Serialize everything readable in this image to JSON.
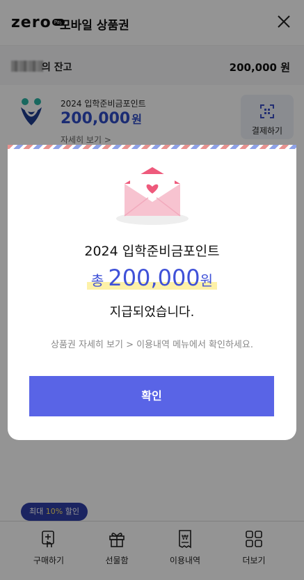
{
  "header": {
    "logo_text": "zero",
    "logo_badge": "Pay",
    "title": "모바일 상품권"
  },
  "balance": {
    "label": "의 잔고",
    "value": "200,000 원"
  },
  "voucher": {
    "name": "2024 입학준비금포인트",
    "amount": "200,000",
    "amount_unit": "원",
    "detail_link": "자세히 보기 >",
    "pay_button": "결제하기"
  },
  "modal": {
    "title": "2024 입학준비금포인트",
    "amount_prefix": "총",
    "amount_value": "200,000",
    "amount_suffix": "원",
    "message": "지급되었습니다.",
    "note": "상품권 자세히 보기 > 이용내역 메뉴에서 확인하세요.",
    "confirm_button": "확인"
  },
  "promo": {
    "prefix": "최대 ",
    "highlight": "10%",
    "suffix": " 할인"
  },
  "bottom_nav": {
    "items": [
      {
        "label": "구매하기",
        "icon": "buy-icon"
      },
      {
        "label": "선물함",
        "icon": "gift-icon"
      },
      {
        "label": "이용내역",
        "icon": "receipt-icon"
      },
      {
        "label": "더보기",
        "icon": "more-grid-icon"
      }
    ]
  },
  "colors": {
    "accent": "#5964e6",
    "amount": "#3f51d8",
    "highlight": "#fdf1a8"
  }
}
